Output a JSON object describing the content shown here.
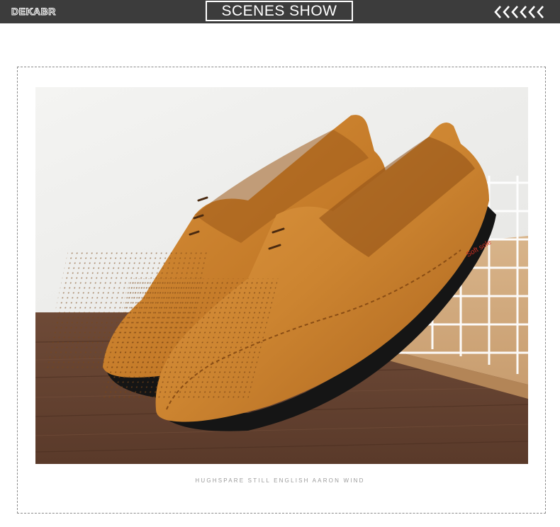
{
  "header": {
    "brand": "DEKABR",
    "title": "SCENES SHOW",
    "chevrons_icon": "chevron-left-multi-icon"
  },
  "photo": {
    "subject": "brown-leather-loafer-photo",
    "sole_text": "Soft sole"
  },
  "caption": "HUGHSPARE STILL ENGLISH AARON WIND",
  "colors": {
    "header_bg": "#3c3c3c",
    "leather": "#c9822f",
    "sole": "#151515"
  }
}
